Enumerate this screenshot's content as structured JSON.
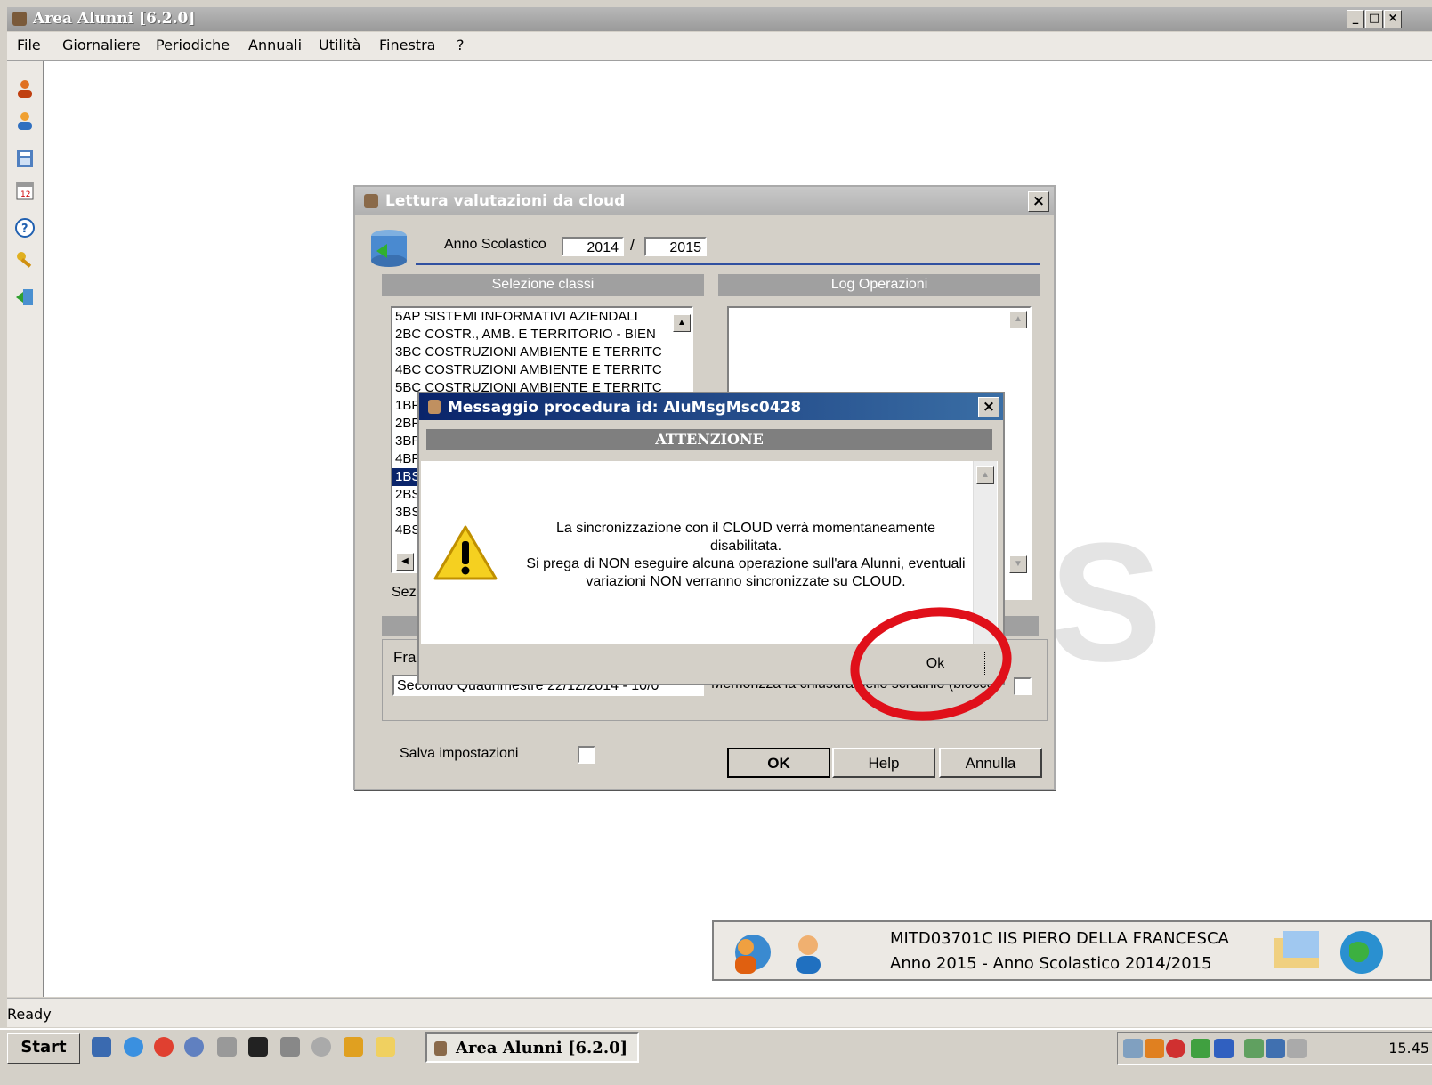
{
  "app": {
    "title": "Area Alunni [6.2.0]"
  },
  "menu": [
    "File",
    "Giornaliere",
    "Periodiche",
    "Annuali",
    "Utilità",
    "Finestra",
    "?"
  ],
  "window_controls": [
    "_",
    "□",
    "×"
  ],
  "status": {
    "text": "Ready"
  },
  "dialog": {
    "title": "Lettura valutazioni da cloud",
    "anno_label": "Anno Scolastico",
    "anno_from": "2014",
    "anno_sep": "/",
    "anno_to": "2015",
    "selezione_header": "Selezione classi",
    "log_header": "Log Operazioni",
    "classes": [
      "5AP SISTEMI INFORMATIVI AZIENDALI",
      "2BC COSTR., AMB. E TERRITORIO - BIEN",
      "3BC COSTRUZIONI AMBIENTE E TERRITC",
      "4BC COSTRUZIONI AMBIENTE E TERRITC",
      "5BC COSTRUZIONI AMBIENTE E TERRITC",
      "1BF",
      "2BF",
      "3BF",
      "4BF",
      "1BS",
      "2BS",
      "3BS",
      "4BS"
    ],
    "selected_index": 9,
    "sez_label": "Sez",
    "fra_label": "Fra",
    "periodo_value": "Secondo Quadrimestre 22/12/2014 - 10/0",
    "memorizza_label": "Memorizza la chiusura dello scrutinio (blocco",
    "salva_label": "Salva impostazioni",
    "ok_label": "OK",
    "help_label": "Help",
    "annulla_label": "Annulla"
  },
  "message": {
    "title": "Messaggio procedura id: AluMsgMsc0428",
    "header": "ATTENZIONE",
    "line1": "La sincronizzazione con il CLOUD verrà momentaneamente",
    "line2": "disabilitata.",
    "line3": "Si prega di NON eseguire alcuna operazione sull'ara Alunni, eventuali",
    "line4": "variazioni NON verranno sincronizzate su CLOUD.",
    "ok_label": "Ok",
    "highlight_color": "#e0101a"
  },
  "school": {
    "line1": "MITD03701C IIS PIERO DELLA FRANCESCA",
    "line2": "Anno 2015  -  Anno Scolastico 2014/2015"
  },
  "taskbar": {
    "start_label": "Start",
    "task_label": "Area Alunni [6.2.0]",
    "clock": "15.45"
  },
  "icons": [
    "user-icon",
    "users-icon",
    "calculator-icon",
    "calendar-icon",
    "help-icon",
    "keys-icon",
    "exit-icon",
    "database-icon",
    "warning-icon",
    "globe-icon"
  ]
}
